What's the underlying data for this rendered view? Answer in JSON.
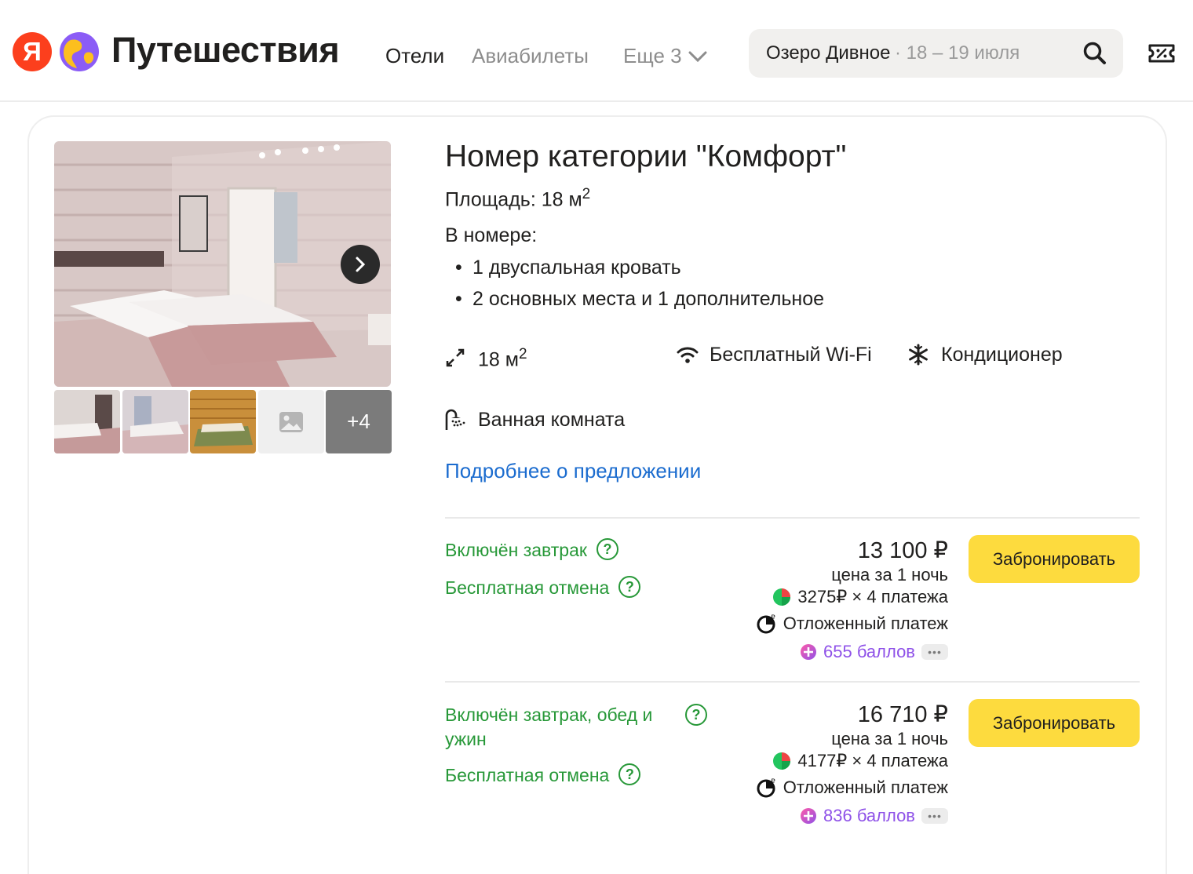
{
  "header": {
    "logo_letter": "Я",
    "logo_text": "Путешествия",
    "nav": {
      "hotels": "Отели",
      "avia": "Авиабилеты",
      "more": "Еще 3"
    },
    "search": {
      "place": "Озеро Дивное",
      "dates": "· 18 – 19 июля"
    }
  },
  "room": {
    "title": "Номер категории \"Комфорт\"",
    "area_label": "Площадь: 18 м",
    "area_sup": "2",
    "in_room_label": "В номере:",
    "beds": [
      "1 двуспальная кровать",
      "2 основных места и 1 дополнительное"
    ],
    "gallery_more": "+4",
    "amenities": {
      "area": "18 м",
      "area_sup": "2",
      "wifi": "Бесплатный Wi-Fi",
      "ac": "Кондиционер",
      "bath": "Ванная комната"
    },
    "details_link": "Подробнее о предложении"
  },
  "offers": [
    {
      "conditions": [
        "Включён завтрак",
        "Бесплатная отмена"
      ],
      "price": "13 100 ₽",
      "per_night": "цена за 1 ночь",
      "split": "3275₽ × 4 платежа",
      "deferred": "Отложенный платеж",
      "points": "655 баллов",
      "button": "Забронировать"
    },
    {
      "conditions": [
        "Включён завтрак, обед и ужин",
        "Бесплатная отмена"
      ],
      "price": "16 710 ₽",
      "per_night": "цена за 1 ночь",
      "split": "4177₽ × 4 платежа",
      "deferred": "Отложенный платеж",
      "points": "836 баллов",
      "button": "Забронировать"
    }
  ],
  "colors": {
    "brand_red": "#fc3f1d",
    "accent_yellow": "#fddb3e",
    "condition_green": "#279838",
    "link_blue": "#1b6ccf",
    "points_purple": "#8f52e8"
  }
}
